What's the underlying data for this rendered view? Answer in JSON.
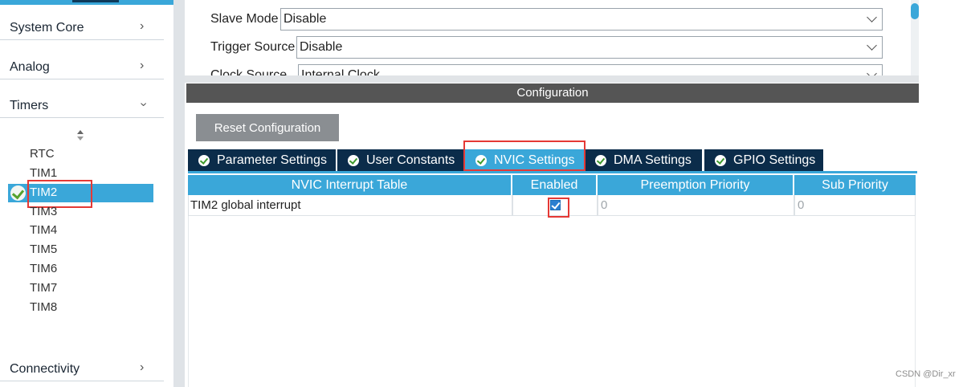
{
  "sidebar": {
    "categories": {
      "system_core": "System Core",
      "analog": "Analog",
      "timers": "Timers",
      "connectivity": "Connectivity"
    },
    "peripherals": {
      "rtc": "RTC",
      "tim1": "TIM1",
      "tim2": "TIM2",
      "tim3": "TIM3",
      "tim4": "TIM4",
      "tim5": "TIM5",
      "tim6": "TIM6",
      "tim7": "TIM7",
      "tim8": "TIM8"
    },
    "selected": "TIM2"
  },
  "mode": {
    "slave_mode_label": "Slave Mode",
    "slave_mode_value": "Disable",
    "trigger_source_label": "Trigger Source",
    "trigger_source_value": "Disable",
    "clock_source_label": "Clock Source",
    "clock_source_value": "Internal Clock"
  },
  "configuration": {
    "header": "Configuration",
    "reset_button": "Reset Configuration",
    "tabs": {
      "parameter": "Parameter Settings",
      "user_constants": "User Constants",
      "nvic": "NVIC Settings",
      "dma": "DMA Settings",
      "gpio": "GPIO Settings"
    },
    "active_tab": "NVIC Settings"
  },
  "nvic_table": {
    "headers": {
      "name": "NVIC Interrupt Table",
      "enabled": "Enabled",
      "preemption": "Preemption Priority",
      "sub": "Sub Priority"
    },
    "rows": [
      {
        "name": "TIM2 global interrupt",
        "enabled": true,
        "preemption": "0",
        "sub": "0"
      }
    ]
  },
  "watermark": "CSDN @Dir_xr",
  "colors": {
    "accent": "#3aa7d9",
    "tab_dark": "#0b2c4a",
    "header_gray": "#555555",
    "highlight_red": "#e53935"
  }
}
